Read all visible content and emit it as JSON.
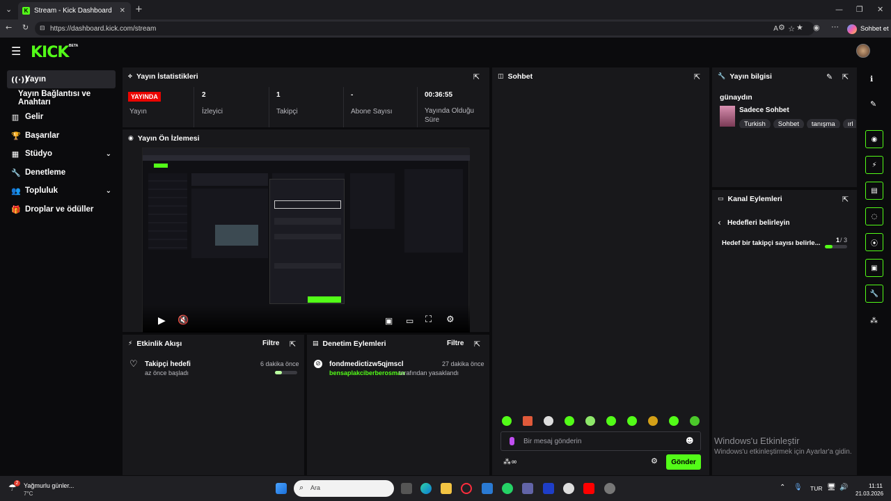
{
  "browser": {
    "tab_title": "Stream - Kick Dashboard",
    "url": "https://dashboard.kick.com/stream",
    "copilot_label": "Sohbet et"
  },
  "app": {
    "logo": "KICK",
    "logo_badge": "BETA"
  },
  "sidebar": {
    "items": [
      {
        "label": "Yayın",
        "icon": "broadcast-icon"
      },
      {
        "label": "Yayın Bağlantısı ve Anahtarı",
        "icon": ""
      },
      {
        "label": "Gelir",
        "icon": "chart-icon"
      },
      {
        "label": "Başarılar",
        "icon": "trophy-icon"
      },
      {
        "label": "Stüdyo",
        "icon": "studio-icon"
      },
      {
        "label": "Denetleme",
        "icon": "wrench-icon"
      },
      {
        "label": "Topluluk",
        "icon": "users-icon"
      },
      {
        "label": "Droplar ve ödüller",
        "icon": "gift-icon"
      }
    ]
  },
  "stats": {
    "title": "Yayın İstatistikleri",
    "live_badge": "YAYINDA",
    "cells": [
      {
        "value": "",
        "label": "Yayın"
      },
      {
        "value": "2",
        "label": "İzleyici"
      },
      {
        "value": "1",
        "label": "Takipçi"
      },
      {
        "value": "-",
        "label": "Abone Sayısı"
      },
      {
        "value": "00:36:55",
        "label": "Yayında Olduğu Süre"
      }
    ]
  },
  "preview": {
    "title": "Yayın Ön İzlemesi"
  },
  "activity": {
    "title": "Etkinlik Akışı",
    "filter": "Filtre",
    "item_title": "Takipçi hedefi",
    "item_sub": "az önce başladı",
    "item_time": "6 dakika önce",
    "progress": 0.3
  },
  "moderation": {
    "title": "Denetim Eylemleri",
    "filter": "Filtre",
    "item_user": "fondmedictizw5qjmscl",
    "item_time": "27 dakika önce",
    "item_actor": "bensaplakciberberosman",
    "item_text": "tarafından yasaklandı"
  },
  "chat": {
    "title": "Sohbet",
    "placeholder": "Bir mesaj gönderin",
    "send": "Gönder"
  },
  "stream_info": {
    "title": "Yayın bilgisi",
    "stream_title": "günaydın",
    "category": "Sadece Sohbet",
    "tags": [
      "Turkish",
      "Sohbet",
      "tanışma",
      "ırl"
    ]
  },
  "channel_actions": {
    "title": "Kanal Eylemleri",
    "back_label": "Hedefleri belirleyin",
    "goal_label": "Hedef bir takipçi sayısı belirle...",
    "goal_current": "1",
    "goal_total": "/ 3",
    "progress": 0.33
  },
  "windows": {
    "activate_title": "Windows'u Etkinleştir",
    "activate_sub": "Windows'u etkinleştirmek için Ayarlar'a gidin.",
    "weather_title": "Yağmurlu günler...",
    "weather_temp": "7°C",
    "weather_badge": "2",
    "search": "Ara",
    "lang": "TUR",
    "time": "11:11",
    "date": "21.03.2026"
  },
  "colors": {
    "accent": "#53fc18",
    "live": "#eb0400",
    "panel": "#18181b"
  }
}
